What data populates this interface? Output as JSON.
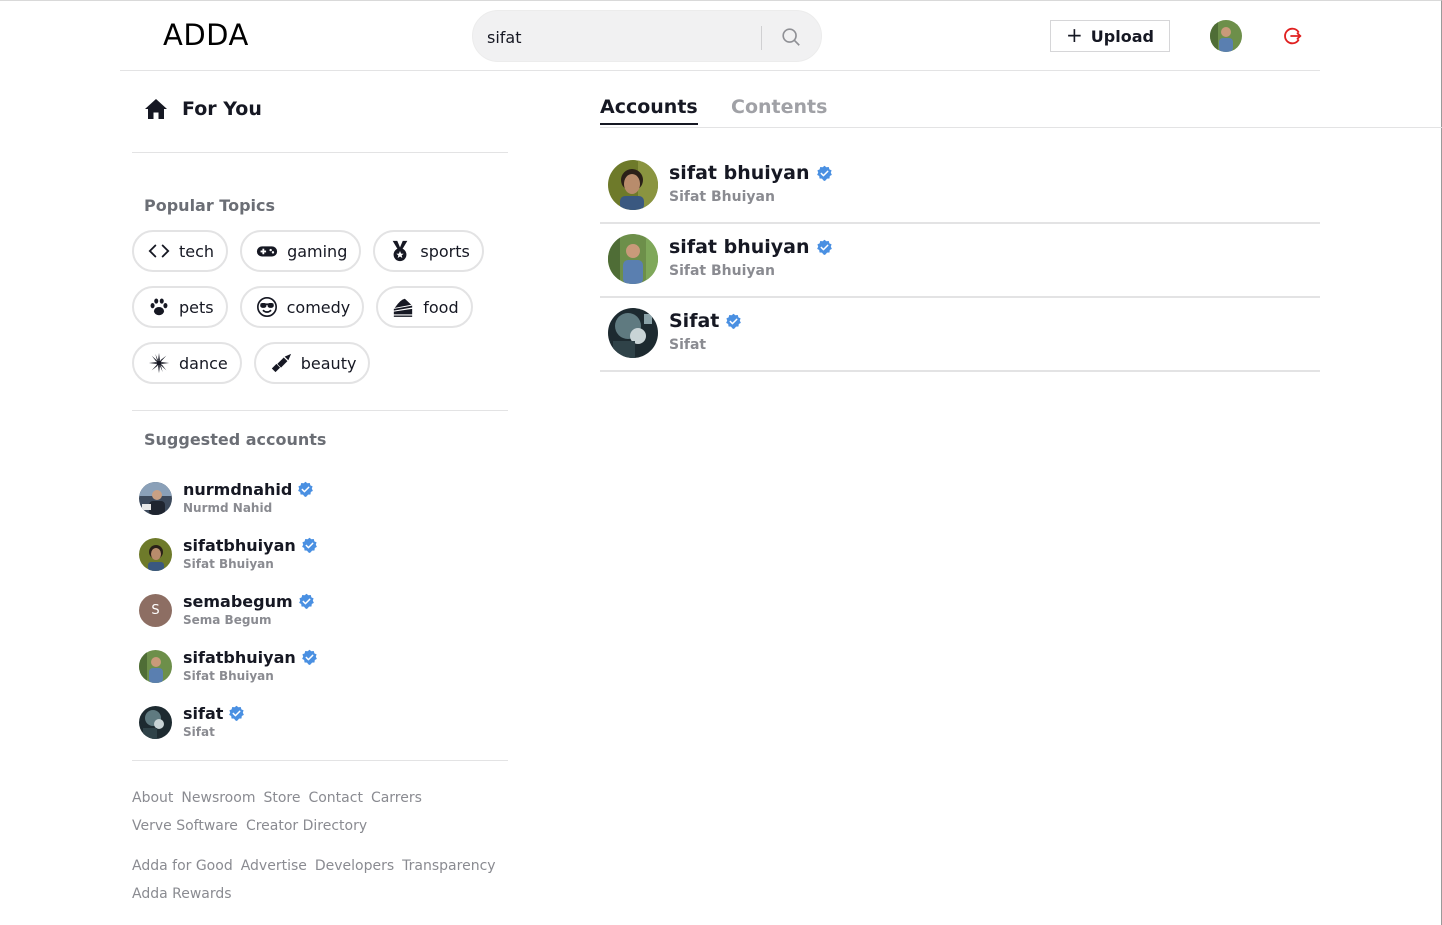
{
  "header": {
    "logo": "ADDA",
    "search_value": "sifat",
    "upload_label": "Upload"
  },
  "sidebar": {
    "for_you": "For You",
    "popular_title": "Popular Topics",
    "topics": [
      {
        "label": "tech",
        "icon": "code-icon"
      },
      {
        "label": "gaming",
        "icon": "gamepad-icon"
      },
      {
        "label": "sports",
        "icon": "medal-icon"
      },
      {
        "label": "pets",
        "icon": "paw-icon"
      },
      {
        "label": "comedy",
        "icon": "sunglasses-smile-icon"
      },
      {
        "label": "food",
        "icon": "cake-icon"
      },
      {
        "label": "dance",
        "icon": "disco-icon"
      },
      {
        "label": "beauty",
        "icon": "lipstick-icon"
      }
    ],
    "suggested_title": "Suggested accounts",
    "suggested": [
      {
        "username": "nurmdnahid",
        "name": "Nurmd Nahid"
      },
      {
        "username": "sifatbhuiyan",
        "name": "Sifat Bhuiyan"
      },
      {
        "username": "semabegum",
        "name": "Sema Begum",
        "initial": "S"
      },
      {
        "username": "sifatbhuiyan",
        "name": "Sifat Bhuiyan"
      },
      {
        "username": "sifat",
        "name": "Sifat"
      }
    ],
    "footer": {
      "line1": [
        "About",
        "Newsroom",
        "Store",
        "Contact",
        "Carrers"
      ],
      "line2": [
        "Verve Software",
        "Creator Directory"
      ],
      "line3": [
        "Adda for Good",
        "Advertise",
        "Developers",
        "Transparency"
      ],
      "line4": [
        "Adda Rewards"
      ]
    }
  },
  "tabs": {
    "accounts": "Accounts",
    "contents": "Contents",
    "active": "Accounts"
  },
  "results": [
    {
      "username": "sifat bhuiyan",
      "name": "Sifat Bhuiyan"
    },
    {
      "username": "sifat bhuiyan",
      "name": "Sifat Bhuiyan"
    },
    {
      "username": "Sifat",
      "name": "Sifat"
    }
  ],
  "colors": {
    "verified": "#4a90e2",
    "logout": "#e02020",
    "muted": "#8a8b91"
  }
}
